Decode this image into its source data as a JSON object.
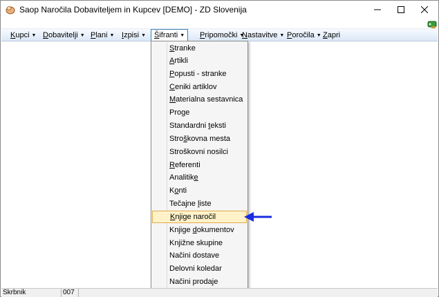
{
  "window": {
    "title": "Saop Naročila Dobaviteljem in Kupcev [DEMO] - ZD Slovenija",
    "minimize_icon": "minimize-icon",
    "maximize_icon": "maximize-icon",
    "close_icon": "close-icon"
  },
  "menubar": {
    "items": [
      {
        "label": "Kupci",
        "underline": "K",
        "rest": "upci",
        "has_arrow": true
      },
      {
        "label": "Dobavitelji",
        "underline": "D",
        "rest": "obavitelji",
        "has_arrow": true
      },
      {
        "label": "Plani",
        "underline": "P",
        "rest": "lani",
        "has_arrow": true
      },
      {
        "label": "Izpisi",
        "underline": "I",
        "rest": "zpisi",
        "has_arrow": true
      },
      {
        "label": "Šifranti",
        "underline": "Š",
        "rest": "ifranti",
        "has_arrow": true
      },
      {
        "label": "Pripomočki",
        "underline": "P",
        "rest": "ripomočki",
        "has_arrow": true
      },
      {
        "label": "Nastavitve",
        "underline": "N",
        "rest": "astavitve",
        "has_arrow": true
      },
      {
        "label": "Poročila",
        "underline": "P",
        "rest": "oročila",
        "has_arrow": true
      },
      {
        "label": "Zapri",
        "underline": "Z",
        "rest": "apri",
        "has_arrow": false
      }
    ],
    "active": "Šifranti"
  },
  "dropdown": {
    "items": [
      {
        "pre": "",
        "ul": "S",
        "post": "tranke"
      },
      {
        "pre": "",
        "ul": "A",
        "post": "rtikli"
      },
      {
        "pre": "",
        "ul": "P",
        "post": "opusti - stranke"
      },
      {
        "pre": "",
        "ul": "C",
        "post": "eniki artiklov"
      },
      {
        "pre": "",
        "ul": "M",
        "post": "aterialna sestavnica"
      },
      {
        "pre": "Pro",
        "ul": "g",
        "post": "e"
      },
      {
        "pre": "Standardni ",
        "ul": "t",
        "post": "eksti"
      },
      {
        "pre": "Stro",
        "ul": "š",
        "post": "kovna mesta"
      },
      {
        "pre": "Stroškovni nosilci",
        "ul": "",
        "post": ""
      },
      {
        "pre": "",
        "ul": "R",
        "post": "eferenti"
      },
      {
        "pre": "Analitik",
        "ul": "e",
        "post": ""
      },
      {
        "pre": "K",
        "ul": "o",
        "post": "nti"
      },
      {
        "pre": "Tečajne ",
        "ul": "l",
        "post": "iste"
      },
      {
        "pre": "",
        "ul": "K",
        "post": "njige naročil"
      },
      {
        "pre": "Knjige ",
        "ul": "d",
        "post": "okumentov"
      },
      {
        "pre": "Knjižne skupine",
        "ul": "",
        "post": ""
      },
      {
        "pre": "Načini dostave",
        "ul": "",
        "post": ""
      },
      {
        "pre": "Delovni koledar",
        "ul": "",
        "post": ""
      },
      {
        "pre": "Načini prodaje",
        "ul": "",
        "post": ""
      }
    ],
    "highlighted": "Knjige naročil"
  },
  "statusbar": {
    "user": "Skrbnik",
    "code": "007"
  },
  "colors": {
    "highlight_bg": "#fff2c9",
    "highlight_border": "#e2a94a",
    "arrow": "#1a2ce0"
  }
}
